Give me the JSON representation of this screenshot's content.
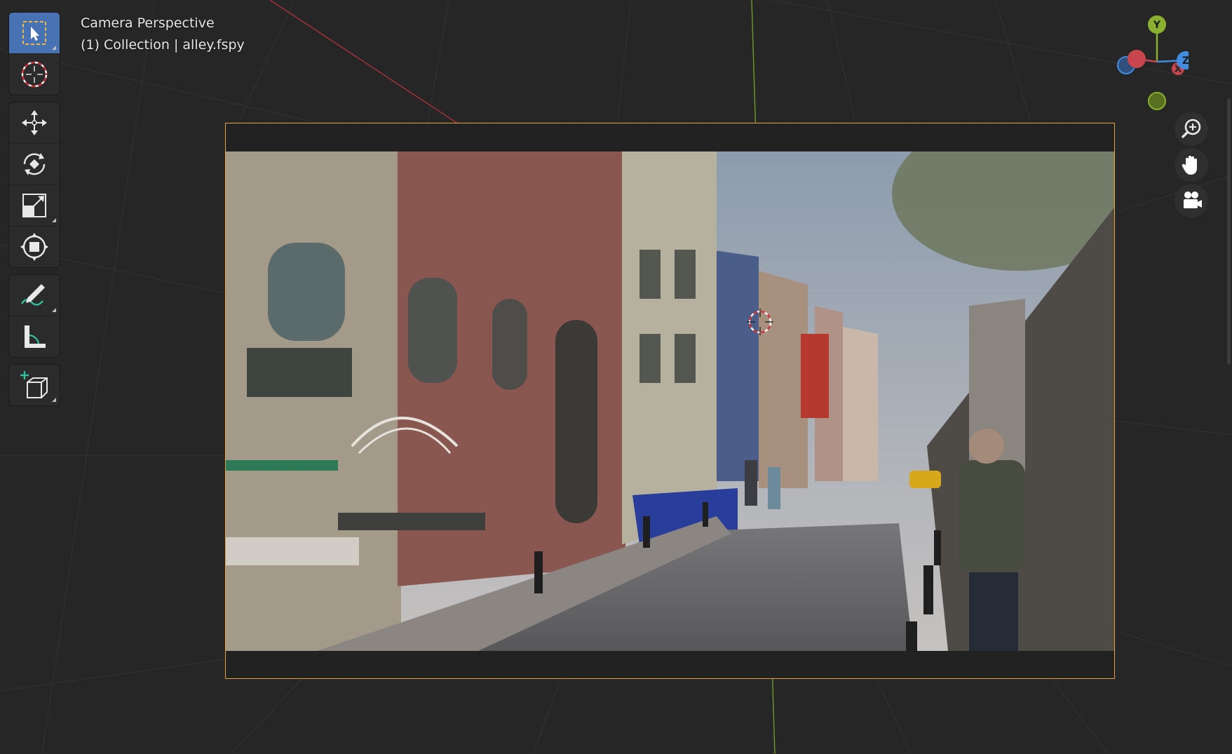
{
  "viewport": {
    "view_name": "Camera Perspective",
    "collection_label": "(1) Collection | alley.fspy"
  },
  "toolbar": {
    "tools": [
      {
        "name": "select-box",
        "icon": "select-box-icon",
        "active": true
      },
      {
        "name": "cursor",
        "icon": "cursor-icon",
        "active": false
      },
      {
        "name": "move",
        "icon": "move-icon",
        "active": false
      },
      {
        "name": "rotate",
        "icon": "rotate-icon",
        "active": false
      },
      {
        "name": "scale",
        "icon": "scale-icon",
        "active": false
      },
      {
        "name": "transform",
        "icon": "transform-icon",
        "active": false
      },
      {
        "name": "annotate",
        "icon": "annotate-icon",
        "active": false
      },
      {
        "name": "measure",
        "icon": "measure-icon",
        "active": false
      },
      {
        "name": "add-cube",
        "icon": "add-cube-icon",
        "active": false
      }
    ]
  },
  "gizmo": {
    "axis_y": "Y",
    "axis_z": "Z",
    "axis_x": "X",
    "colors": {
      "x": "#c9464e",
      "y": "#8bb02f",
      "z": "#3f8ce0"
    }
  },
  "nav_buttons": [
    {
      "icon": "zoom-icon"
    },
    {
      "icon": "pan-hand-icon"
    },
    {
      "icon": "camera-view-icon"
    }
  ],
  "colors": {
    "background": "#262626",
    "camera_frame": "#e8a33b",
    "active_tool": "#4772b3"
  }
}
